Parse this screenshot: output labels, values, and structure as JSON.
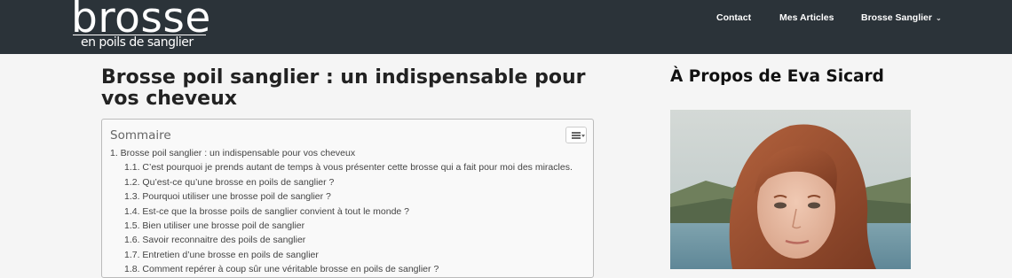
{
  "header": {
    "logo": {
      "main": "brosse",
      "sub": "en poils de sanglier"
    },
    "nav": [
      {
        "label": "Contact"
      },
      {
        "label": "Mes Articles"
      },
      {
        "label": "Brosse Sanglier"
      }
    ],
    "dropdown_icon": "chevron-down-icon"
  },
  "article": {
    "title": "Brosse poil sanglier : un indispensable pour vos cheveux"
  },
  "toc": {
    "title": "Sommaire",
    "toggle_icon": "list-icon",
    "items": [
      {
        "label": "1. Brosse poil sanglier : un indispensable pour vos cheveux",
        "level": 1
      },
      {
        "label": "1.1. C’est pourquoi je prends autant de temps à vous présenter cette brosse qui a fait pour moi des miracles.",
        "level": 2
      },
      {
        "label": "1.2. Qu’est-ce qu’une brosse en poils de sanglier ?",
        "level": 2
      },
      {
        "label": "1.3. Pourquoi utiliser une brosse poil de sanglier ?",
        "level": 2
      },
      {
        "label": "1.4. Est-ce que la brosse poils de sanglier convient à tout le monde ?",
        "level": 2
      },
      {
        "label": "1.5. Bien utiliser une brosse poil de sanglier",
        "level": 2
      },
      {
        "label": "1.6. Savoir reconnaitre des poils de sanglier",
        "level": 2
      },
      {
        "label": "1.7. Entretien d’une brosse en poils de sanglier",
        "level": 2
      },
      {
        "label": "1.8. Comment repérer à coup sûr une véritable brosse en poils de sanglier ?",
        "level": 2
      }
    ]
  },
  "sidebar": {
    "title": "À Propos de Eva Sicard"
  },
  "colors": {
    "header_bg": "#2b3339",
    "page_bg": "#f5f5f5",
    "toc_bg": "#f9f9f9"
  }
}
